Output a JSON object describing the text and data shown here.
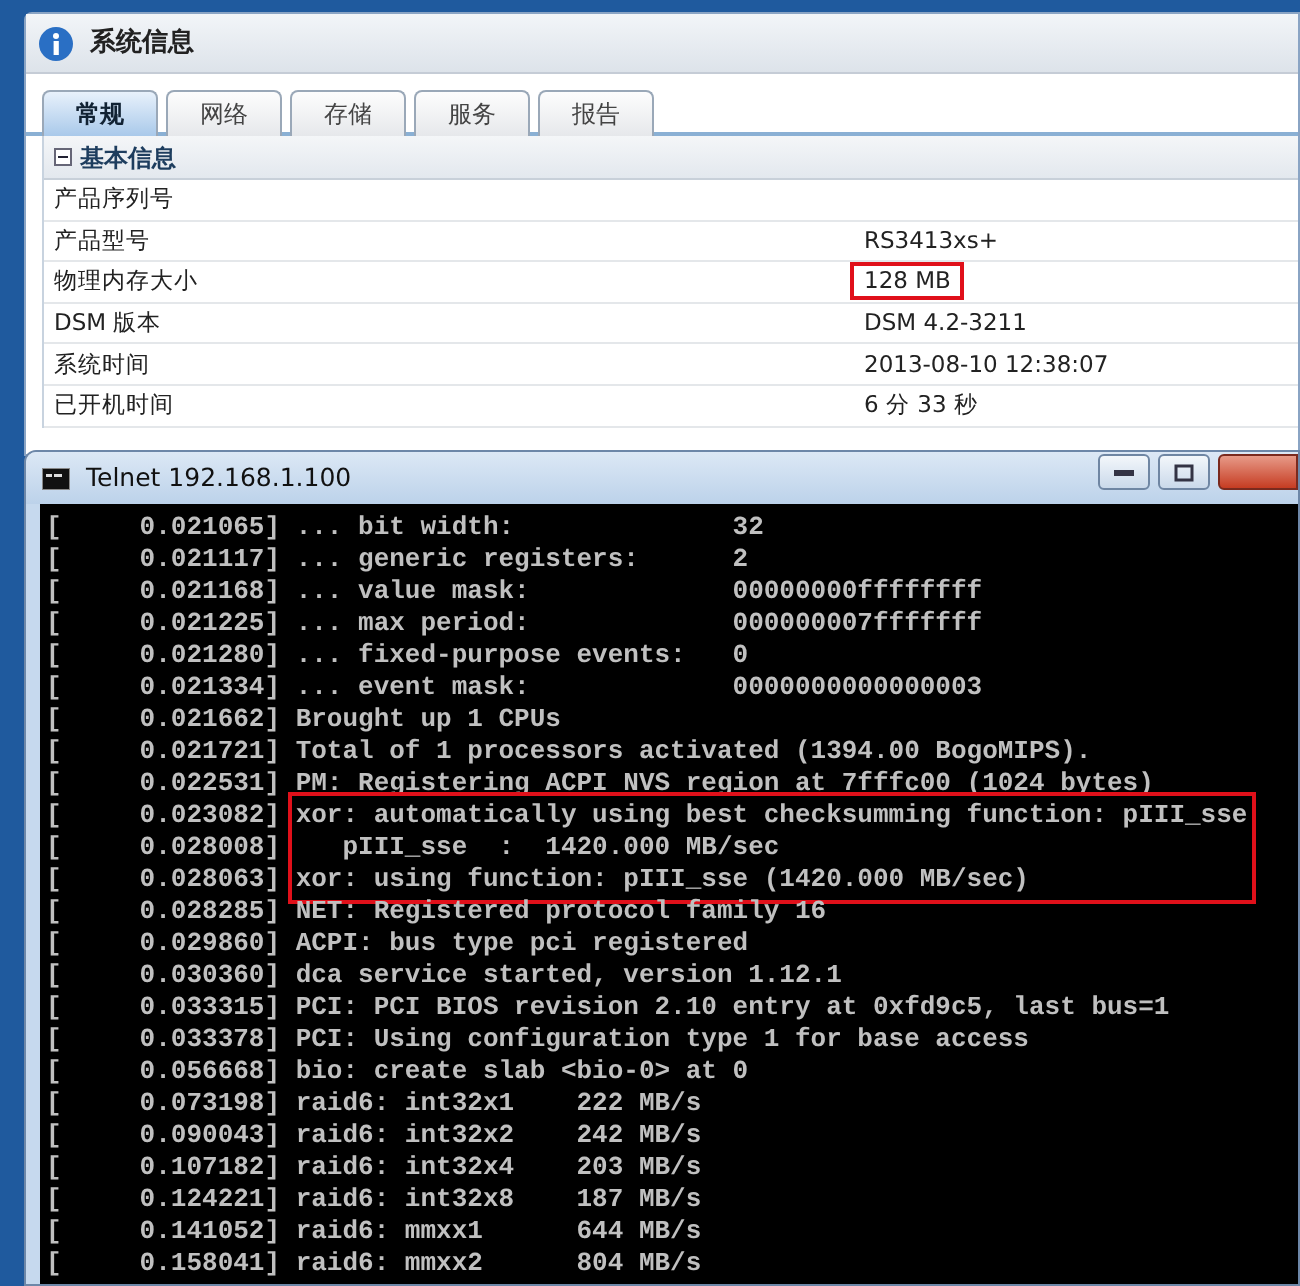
{
  "info_window": {
    "title": "系统信息",
    "tabs": [
      {
        "label": "常规",
        "selected": true
      },
      {
        "label": "网络",
        "selected": false
      },
      {
        "label": "存储",
        "selected": false
      },
      {
        "label": "服务",
        "selected": false
      },
      {
        "label": "报告",
        "selected": false
      }
    ],
    "section": {
      "title": "基本信息",
      "expanded": true
    },
    "rows": [
      {
        "label": "产品序列号"
      },
      {
        "label": "产品型号",
        "value": "RS3413xs+",
        "highlighted": false
      },
      {
        "label": "物理内存大小",
        "value": "128 MB",
        "highlighted": true
      },
      {
        "label": "DSM 版本",
        "value": "DSM 4.2-3211",
        "highlighted": false
      },
      {
        "label": "系统时间",
        "value": "2013-08-10 12:38:07",
        "highlighted": false
      },
      {
        "label": "已开机时间",
        "value": "6 分 33 秒",
        "highlighted": false
      }
    ]
  },
  "telnet_window": {
    "title": "Telnet 192.168.1.100",
    "blocks": [
      {
        "highlighted": false,
        "lines": [
          {
            "time": "[     0.021065]",
            "message": "... bit width:              32"
          },
          {
            "time": "[     0.021117]",
            "message": "... generic registers:      2"
          },
          {
            "time": "[     0.021168]",
            "message": "... value mask:             00000000ffffffff"
          },
          {
            "time": "[     0.021225]",
            "message": "... max period:             000000007fffffff"
          },
          {
            "time": "[     0.021280]",
            "message": "... fixed-purpose events:   0"
          },
          {
            "time": "[     0.021334]",
            "message": "... event mask:             0000000000000003"
          },
          {
            "time": "[     0.021662]",
            "message": "Brought up 1 CPUs"
          },
          {
            "time": "[     0.021721]",
            "message": "Total of 1 processors activated (1394.00 BogoMIPS)."
          },
          {
            "time": "[     0.022531]",
            "message": "PM: Registering ACPI NVS region at 7fffc00 (1024 bytes)"
          }
        ]
      },
      {
        "highlighted": true,
        "lines": [
          {
            "time": "[     0.023082]",
            "message": "xor: automatically using best checksumming function: pIII_sse"
          },
          {
            "time": "[     0.028008]",
            "message": "   pIII_sse  :  1420.000 MB/sec"
          },
          {
            "time": "[     0.028063]",
            "message": "xor: using function: pIII_sse (1420.000 MB/sec)"
          }
        ]
      },
      {
        "highlighted": false,
        "lines": [
          {
            "time": "[     0.028285]",
            "message": "NET: Registered protocol family 16"
          },
          {
            "time": "[     0.029860]",
            "message": "ACPI: bus type pci registered"
          },
          {
            "time": "[     0.030360]",
            "message": "dca service started, version 1.12.1"
          },
          {
            "time": "[     0.033315]",
            "message": "PCI: PCI BIOS revision 2.10 entry at 0xfd9c5, last bus=1"
          },
          {
            "time": "[     0.033378]",
            "message": "PCI: Using configuration type 1 for base access"
          },
          {
            "time": "[     0.056668]",
            "message": "bio: create slab <bio-0> at 0"
          },
          {
            "time": "[     0.073198]",
            "message": "raid6: int32x1    222 MB/s"
          },
          {
            "time": "[     0.090043]",
            "message": "raid6: int32x2    242 MB/s"
          },
          {
            "time": "[     0.107182]",
            "message": "raid6: int32x4    203 MB/s"
          },
          {
            "time": "[     0.124221]",
            "message": "raid6: int32x8    187 MB/s"
          },
          {
            "time": "[     0.141052]",
            "message": "raid6: mmxx1      644 MB/s"
          },
          {
            "time": "[     0.158041]",
            "message": "raid6: mmxx2      804 MB/s"
          }
        ]
      }
    ]
  }
}
